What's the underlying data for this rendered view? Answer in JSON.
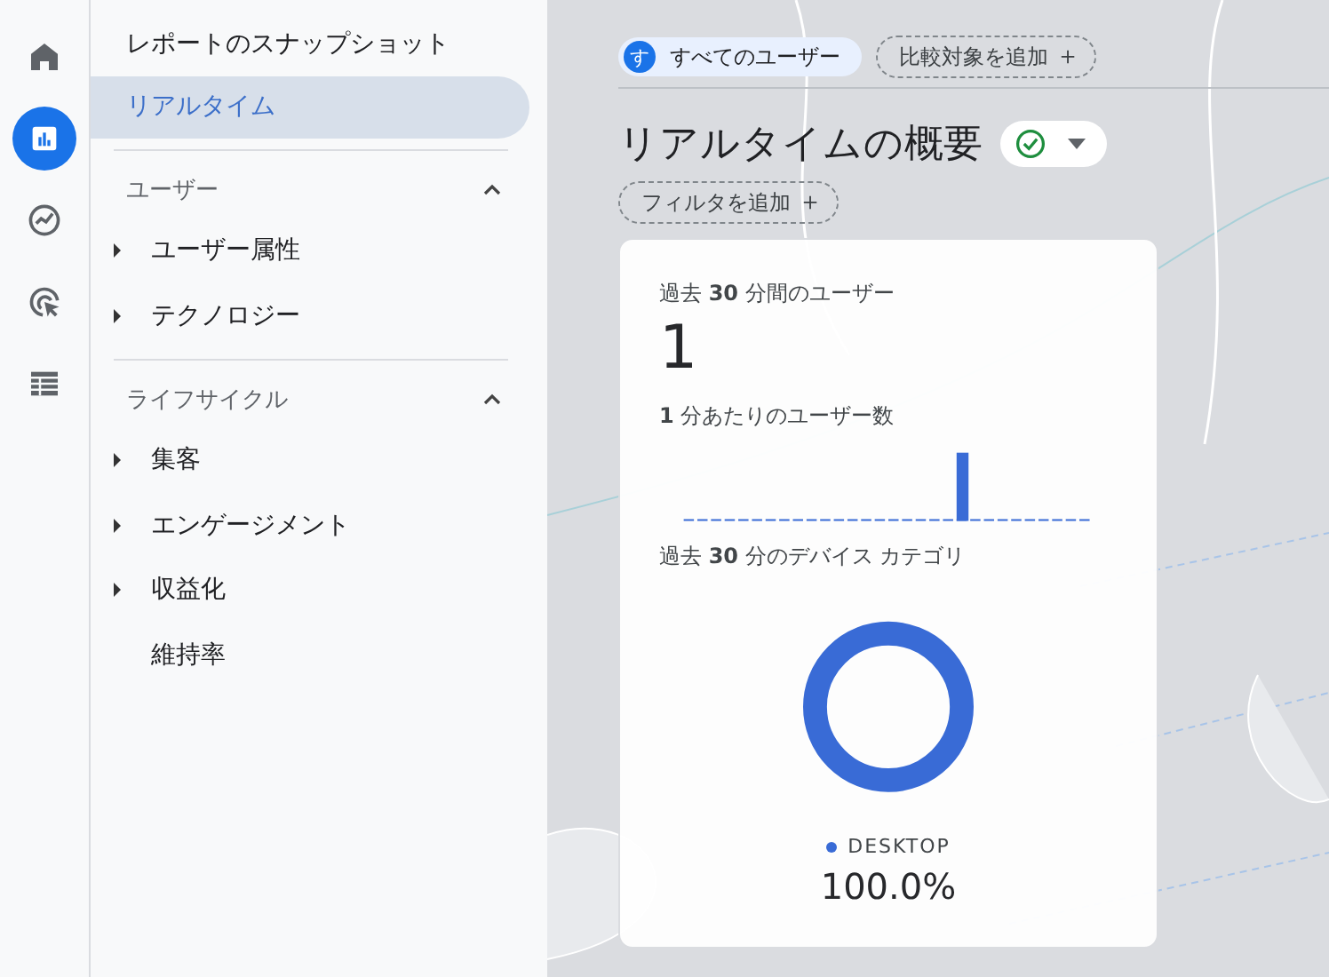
{
  "rail": [
    {
      "kind": "home",
      "selected": false
    },
    {
      "kind": "reports",
      "selected": true
    },
    {
      "kind": "explore",
      "selected": false
    },
    {
      "kind": "advertising",
      "selected": false
    },
    {
      "kind": "list",
      "selected": false
    }
  ],
  "sidebar": {
    "top_items": [
      {
        "label": "レポートのスナップショット",
        "selected": false
      },
      {
        "label": "リアルタイム",
        "selected": true
      }
    ],
    "sections": [
      {
        "title": "ユーザー",
        "expanded": true,
        "items": [
          {
            "label": "ユーザー属性",
            "kind": "group"
          },
          {
            "label": "テクノロジー",
            "kind": "group"
          }
        ]
      },
      {
        "title": "ライフサイクル",
        "expanded": true,
        "items": [
          {
            "label": "集客",
            "kind": "group"
          },
          {
            "label": "エンゲージメント",
            "kind": "group"
          },
          {
            "label": "収益化",
            "kind": "group"
          },
          {
            "label": "維持率",
            "kind": "link"
          }
        ]
      }
    ]
  },
  "comparison": {
    "chip_avatar": "す",
    "chip_label": "すべてのユーザー",
    "add_label": "比較対象を追加",
    "add_icon": "＋"
  },
  "page_title": "リアルタイムの概要",
  "filter": {
    "label": "フィルタを追加",
    "icon": "＋"
  },
  "card": {
    "users_label": "過去 **30** 分間のユーザー",
    "users_value": "1",
    "per_minute_label": "**1** 分あたりのユーザー数",
    "device_label": "過去 **30** 分のデバイス カテゴリ",
    "legend": {
      "label": "DESKTOP",
      "color": "#3367d6"
    },
    "share": "100.0%"
  }
}
